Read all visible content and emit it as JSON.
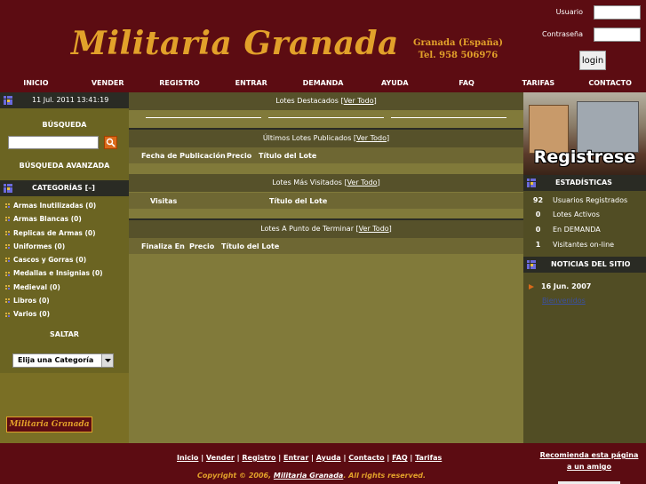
{
  "header": {
    "logo": "Militaria Granada",
    "location_line1": "Granada (España)",
    "location_line2": "Tel. 958 506976",
    "usuario_label": "Usuario",
    "password_label": "Contraseña",
    "login_button": "login"
  },
  "nav": [
    "INICIO",
    "VENDER",
    "REGISTRO",
    "ENTRAR",
    "DEMANDA",
    "AYUDA",
    "FAQ",
    "TARIFAS",
    "CONTACTO"
  ],
  "left": {
    "datetime": "11 Jul. 2011 13:41:19",
    "search_title": "BÚSQUEDA",
    "advanced_search": "BÚSQUEDA AVANZADA",
    "categories_title": "CATEGORÍAS [–]",
    "categories": [
      "Armas Inutilizadas (0)",
      "Armas Blancas (0)",
      "Replicas de Armas (0)",
      "Uniformes (0)",
      "Cascos y Gorras (0)",
      "Medallas e Insignias (0)",
      "Medieval (0)",
      "Libros (0)",
      "Varios (0)"
    ],
    "jump_title": "SALTAR",
    "jump_select": "Elija una Categoría",
    "footer_logo": "Militaria Granada"
  },
  "center": {
    "featured": {
      "title": "Lotes Destacados [",
      "link": "Ver Todo",
      "close": "]"
    },
    "latest": {
      "title": "Últimos Lotes Publicados [",
      "link": "Ver Todo",
      "close": "]",
      "cols": [
        "Fecha de Publicación",
        "Precio",
        "Título del Lote"
      ]
    },
    "most_viewed": {
      "title": "Lotes Más Visitados [",
      "link": "Ver Todo",
      "close": "]",
      "cols": [
        "Visitas",
        "Título del Lote"
      ]
    },
    "ending": {
      "title": "Lotes A Punto de Terminar [",
      "link": "Ver Todo",
      "close": "]",
      "cols": [
        "Finaliza En",
        "Precio",
        "Título del Lote"
      ]
    }
  },
  "right": {
    "register_banner": "Registrese",
    "stats_title": "ESTADÍSTICAS",
    "stats": [
      {
        "num": "92",
        "label": "Usuarios Registrados"
      },
      {
        "num": "0",
        "label": "Lotes Activos"
      },
      {
        "num": "0",
        "label": "En DEMANDA"
      },
      {
        "num": "1",
        "label": "Visitantes on-line"
      }
    ],
    "news_title": "NOTICIAS DEL SITIO",
    "news_date": "16 Jun. 2007",
    "news_link": "Bienvenidos"
  },
  "footer": {
    "links": [
      "Inicio",
      "Vender",
      "Registro",
      "Entrar",
      "Ayuda",
      "Contacto",
      "FAQ",
      "Tarifas"
    ],
    "copyright_pre": "Copyright © 2006, ",
    "copyright_link": "Militaria Granada",
    "copyright_post": ". All rights reserved.",
    "recommend": "Recomienda esta página a un amigo"
  }
}
